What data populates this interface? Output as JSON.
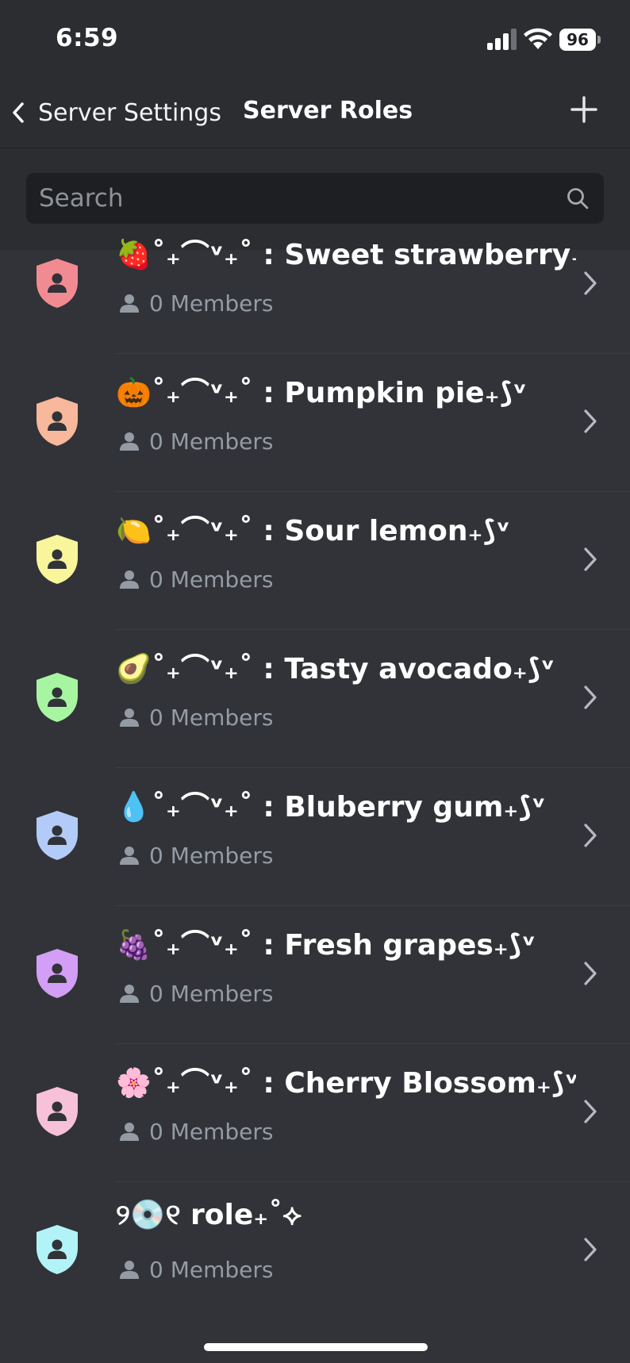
{
  "status_bar": {
    "time": "6:59",
    "battery": "96",
    "signal_icon": "cellular-signal-icon",
    "wifi_icon": "wifi-icon"
  },
  "nav": {
    "back_label": "Server Settings",
    "title": "Server Roles",
    "add_icon": "plus-icon"
  },
  "search": {
    "placeholder": "Search",
    "value": ""
  },
  "roles": [
    {
      "name": "🍓˚₊⌒ᵛ₊˚ : Sweet strawberry₊⟆ᵛ",
      "members": "0 Members",
      "color": "#f28b91"
    },
    {
      "name": "🎃˚₊⌒ᵛ₊˚ : Pumpkin pie₊⟆ᵛ",
      "members": "0 Members",
      "color": "#f7b89b"
    },
    {
      "name": "🍋˚₊⌒ᵛ₊˚ : Sour lemon₊⟆ᵛ",
      "members": "0 Members",
      "color": "#f8f59b"
    },
    {
      "name": "🥑˚₊⌒ᵛ₊˚ : Tasty avocado₊⟆ᵛ",
      "members": "0 Members",
      "color": "#a7f5a1"
    },
    {
      "name": "💧˚₊⌒ᵛ₊˚ : Bluberry gum₊⟆ᵛ",
      "members": "0 Members",
      "color": "#b3cbf8"
    },
    {
      "name": "🍇˚₊⌒ᵛ₊˚ : Fresh grapes₊⟆ᵛ",
      "members": "0 Members",
      "color": "#d39ef5"
    },
    {
      "name": "🌸˚₊⌒ᵛ₊˚ : Cherry Blossom₊⟆ᵛ",
      "members": "0 Members",
      "color": "#f7c1d8"
    },
    {
      "name": "୨💿୧ role₊˚⟡",
      "members": "0 Members",
      "color": "#b2f3f7"
    }
  ],
  "colors": {
    "background": "#313338",
    "header": "#2b2d31",
    "search_field": "#1e1f22",
    "muted_text": "#949ba4"
  }
}
